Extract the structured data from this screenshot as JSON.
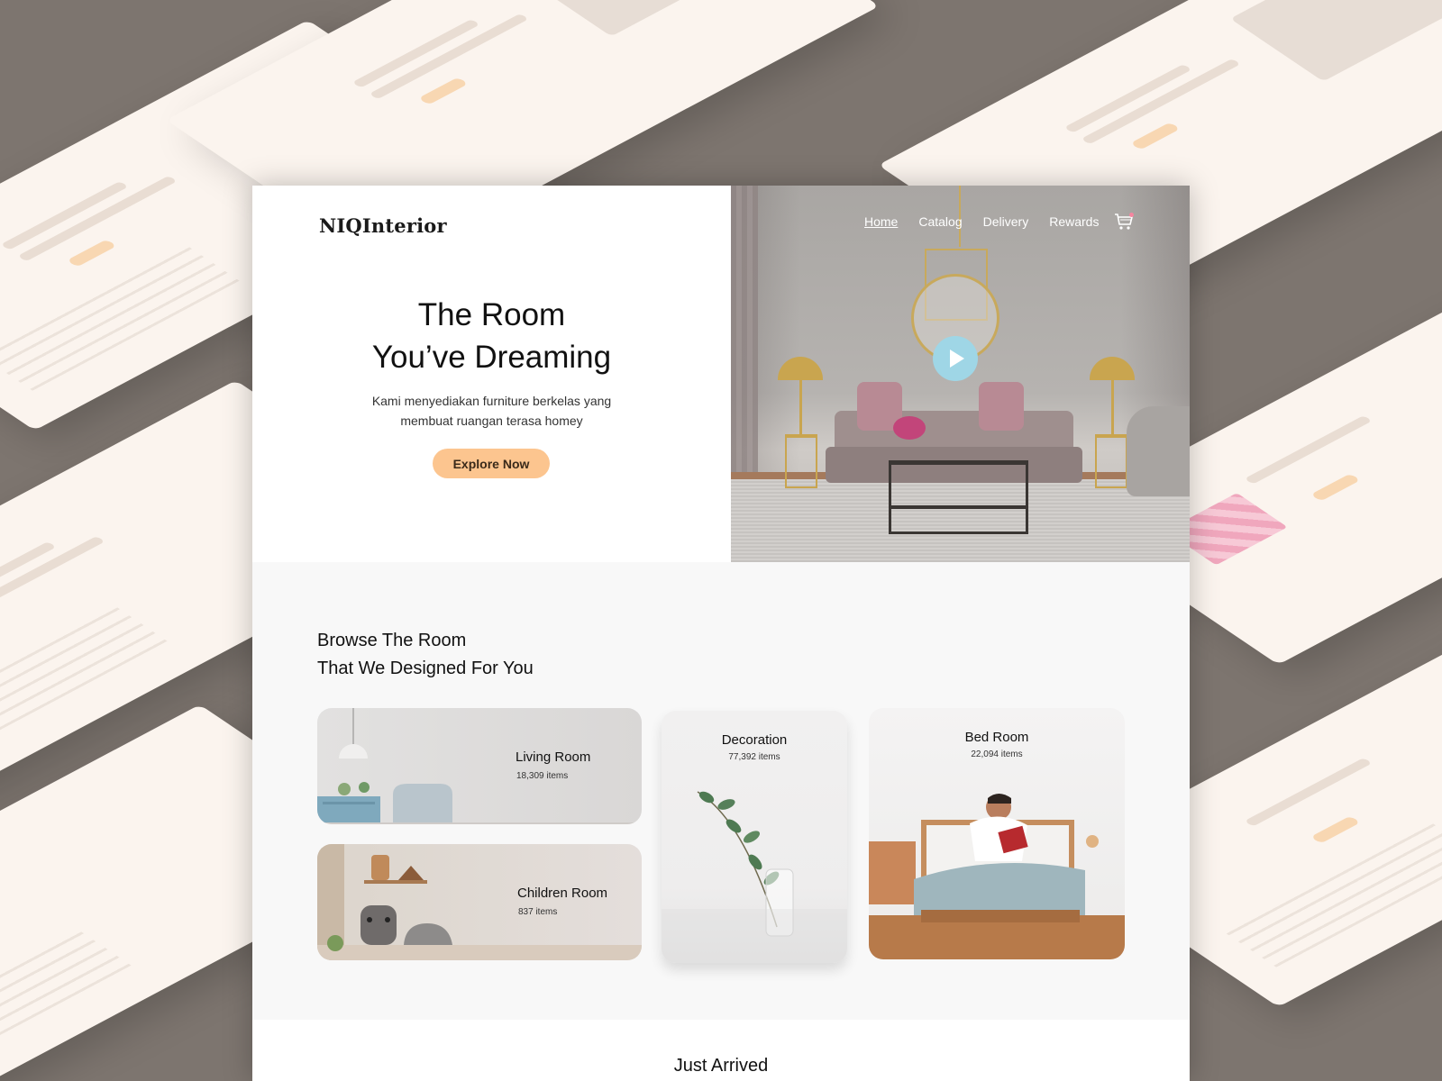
{
  "brand": {
    "logo": "NIQInterior"
  },
  "nav": {
    "items": [
      {
        "label": "Home",
        "active": true
      },
      {
        "label": "Catalog",
        "active": false
      },
      {
        "label": "Delivery",
        "active": false
      },
      {
        "label": "Rewards",
        "active": false
      }
    ],
    "cart_icon": "cart-icon"
  },
  "hero": {
    "title_line1": "The Room",
    "title_line2": "You’ve Dreaming",
    "subtitle_line1": "Kami menyediakan furniture berkelas yang",
    "subtitle_line2": "membuat ruangan terasa homey",
    "cta_label": "Explore Now",
    "media_icon": "play-icon"
  },
  "browse": {
    "title_line1": "Browse The Room",
    "title_line2": "That We Designed For You",
    "cards": [
      {
        "name": "Living Room",
        "count": "18,309 items"
      },
      {
        "name": "Children Room",
        "count": "837 items"
      },
      {
        "name": "Decoration",
        "count": "77,392 items"
      },
      {
        "name": "Bed Room",
        "count": "22,094 items"
      }
    ]
  },
  "next_section": {
    "title": "Just Arrived"
  },
  "colors": {
    "accent": "#fcc58f",
    "play_button": "#9fd6e6",
    "section_bg": "#f8f8f8",
    "backdrop": "#7d756f"
  }
}
